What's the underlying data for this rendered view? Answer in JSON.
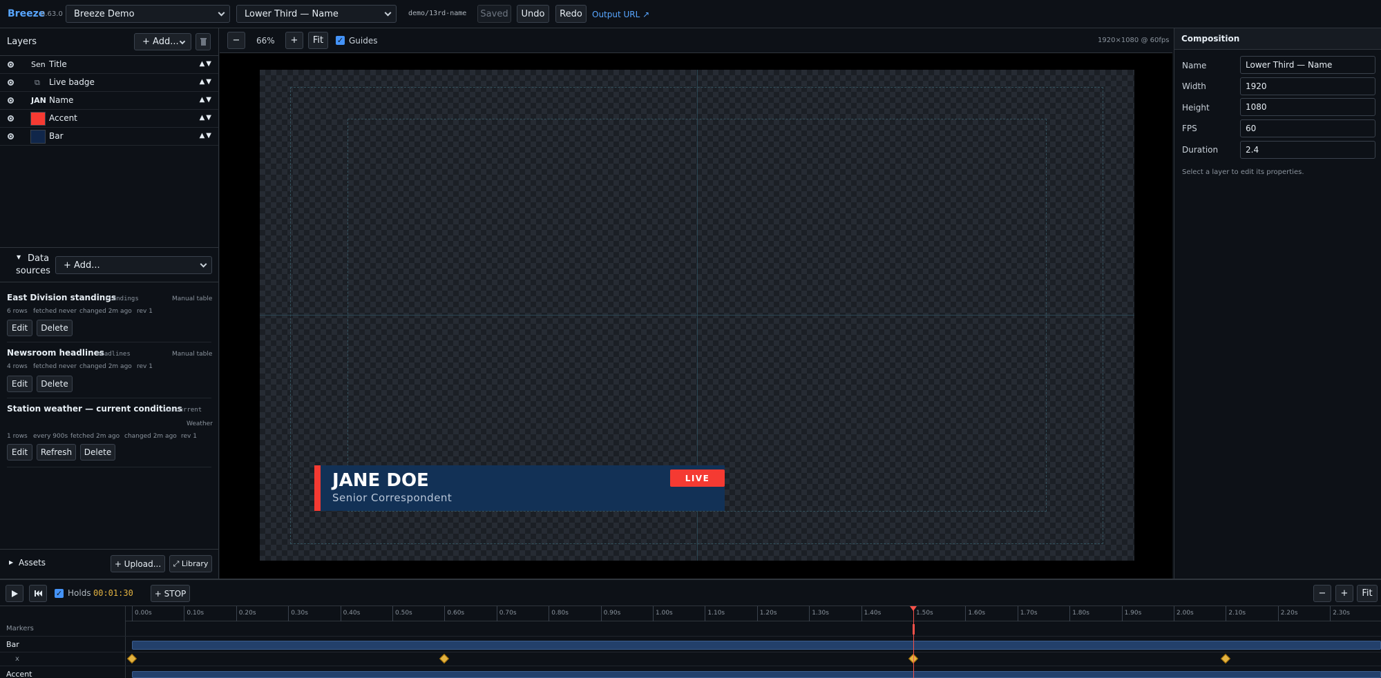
{
  "topbar": {
    "app_name": "Breeze",
    "version": "0.63.0",
    "project_select": "Breeze Demo",
    "graphic_select": "Lower Third — Name",
    "slug": "demo/13rd-name",
    "saved_label": "Saved",
    "undo_label": "Undo",
    "redo_label": "Redo",
    "output_url_label": "Output URL ↗"
  },
  "layers_panel": {
    "title": "Layers",
    "add_label": "+ Add...",
    "delete_icon": "trash-icon",
    "updown_label": "▲▼",
    "items": [
      {
        "thumb": "Sen",
        "thumb_kind": "text",
        "name": "Title"
      },
      {
        "thumb": "⧉",
        "thumb_kind": "group",
        "name": "Live badge"
      },
      {
        "thumb": "JAN",
        "thumb_kind": "text",
        "name": "Name"
      },
      {
        "thumb": "",
        "thumb_kind": "swatch",
        "color": "#f53a32",
        "name": "Accent"
      },
      {
        "thumb": "",
        "thumb_kind": "swatch",
        "color": "#10264a",
        "name": "Bar"
      }
    ]
  },
  "data_sources": {
    "title_line1": "Data",
    "title_line2": "sources",
    "add_label": "+ Add...",
    "items": [
      {
        "name": "East Division standings",
        "slug": "standings",
        "type": "Manual table",
        "meta": [
          "6 rows",
          "fetched never",
          "changed 2m ago",
          "rev 1"
        ],
        "buttons": [
          "Edit",
          "Delete"
        ]
      },
      {
        "name": "Newsroom headlines",
        "slug": "headlines",
        "type": "Manual table",
        "meta": [
          "4 rows",
          "fetched never",
          "changed 2m ago",
          "rev 1"
        ],
        "buttons": [
          "Edit",
          "Delete"
        ]
      },
      {
        "name": "Station weather — current conditions",
        "slug": "wx-current",
        "type": "Weather",
        "meta": [
          "1 rows",
          "every 900s",
          "fetched 2m ago",
          "changed 2m ago",
          "rev 1"
        ],
        "buttons": [
          "Edit",
          "Refresh",
          "Delete"
        ]
      }
    ]
  },
  "assets": {
    "title": "Assets",
    "upload_label": "+ Upload...",
    "library_label": "⤢ Library"
  },
  "canvas_toolbar": {
    "zoom_out": "−",
    "zoom": "66%",
    "zoom_in": "+",
    "fit": "Fit",
    "guides_label": "Guides",
    "guides_checked": true,
    "resolution": "1920×1080 @ 60fps"
  },
  "lower_third": {
    "name": "JANE DOE",
    "subtitle": "Senior Correspondent",
    "live_badge": "LIVE",
    "accent_color": "#f53a32",
    "bar_color": "#10264a"
  },
  "composition": {
    "title": "Composition",
    "fields": [
      {
        "label": "Name",
        "value": "Lower Third — Name"
      },
      {
        "label": "Width",
        "value": "1920"
      },
      {
        "label": "Height",
        "value": "1080"
      },
      {
        "label": "FPS",
        "value": "60"
      },
      {
        "label": "Duration",
        "value": "2.4"
      }
    ],
    "hint": "Select a layer to edit its properties."
  },
  "timeline": {
    "play_icon": "play-icon",
    "rewind_icon": "skip-back-icon",
    "holds_label": "Holds",
    "holds_checked": true,
    "timecode": "00:01:30",
    "stop_label": "+ STOP",
    "zoom_out": "−",
    "zoom_in": "+",
    "fit": "Fit",
    "playhead_time": 1.5,
    "ticks": [
      "0.00s",
      "0.10s",
      "0.20s",
      "0.30s",
      "0.40s",
      "0.50s",
      "0.60s",
      "0.70s",
      "0.80s",
      "0.90s",
      "1.00s",
      "1.10s",
      "1.20s",
      "1.30s",
      "1.40s",
      "1.50s",
      "1.60s",
      "1.70s",
      "1.80s",
      "1.90s",
      "2.00s",
      "2.10s",
      "2.20s",
      "2.30s"
    ],
    "tracks": [
      {
        "label": "Markers"
      },
      {
        "label": "Bar"
      },
      {
        "label": "x",
        "keyframes": [
          0.0,
          0.6,
          1.5,
          2.1
        ]
      },
      {
        "label": "Accent"
      }
    ]
  }
}
